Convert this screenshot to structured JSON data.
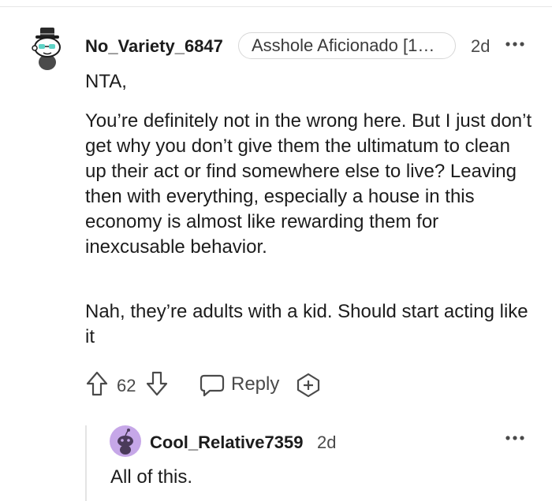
{
  "comment": {
    "username": "No_Variety_6847",
    "flair": "Asshole Aficionado [1…",
    "time": "2d",
    "paragraphs": [
      "NTA,",
      "You’re definitely not in the wrong here. But I just don’t get why you don’t give them the ultimatum to clean up their act or find somewhere else to live? Leaving then with everything, especially a house in this economy is almost like rewarding them for inexcusable behavior.",
      "Nah, they’re adults with a kid. Should start acting like it"
    ],
    "score": "62",
    "reply_label": "Reply"
  },
  "reply": {
    "username": "Cool_Relative7359",
    "time": "2d",
    "text": "All of this."
  },
  "icons": {
    "avatar": "snoo-avatar-top-hat",
    "upvote": "upvote-arrow-icon",
    "downvote": "downvote-arrow-icon",
    "reply": "speech-bubble-icon",
    "award": "award-plus-icon",
    "more": "more-dots-icon"
  },
  "colors": {
    "text": "#1c1c1c",
    "meta": "#4a4a4a",
    "avatar_purple": "#c6a7e8",
    "avatar_teal": "#5fd3c6"
  }
}
